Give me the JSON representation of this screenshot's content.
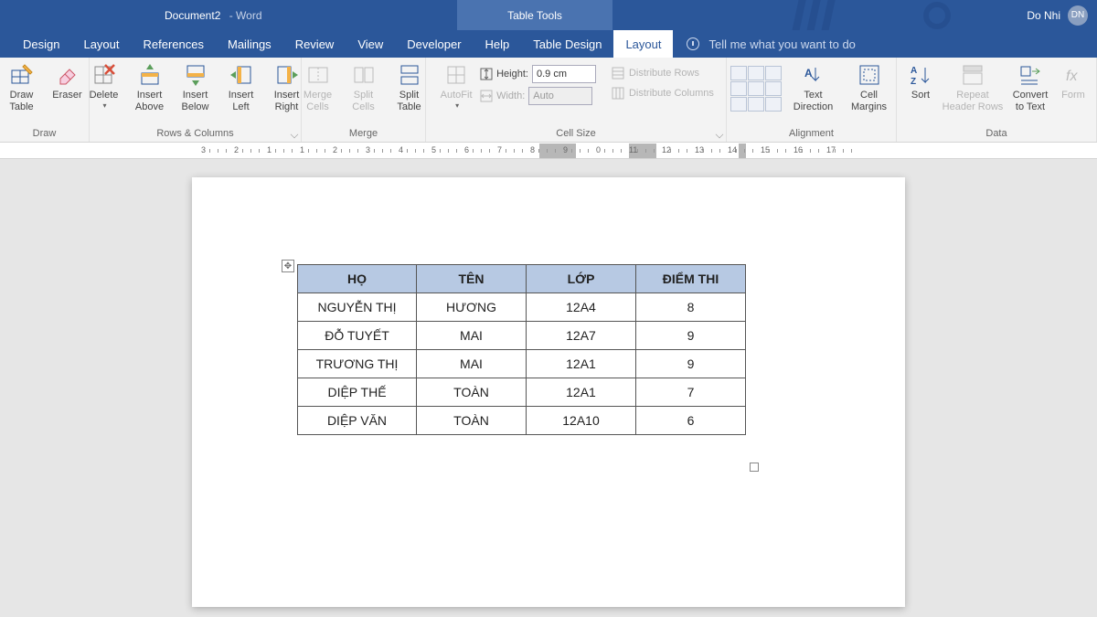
{
  "title": {
    "doc": "Document2",
    "sep": " - ",
    "app": "Word",
    "context": "Table Tools"
  },
  "user": {
    "name": "Do Nhi",
    "initials": "DN"
  },
  "tabs": {
    "list": [
      "Design",
      "Layout",
      "References",
      "Mailings",
      "Review",
      "View",
      "Developer",
      "Help",
      "Table Design",
      "Layout"
    ],
    "active_index": 9,
    "tell_me": "Tell me what you want to do"
  },
  "ribbon": {
    "groups": {
      "draw": {
        "label": "Draw",
        "draw_table": "Draw\nTable",
        "eraser": "Eraser"
      },
      "rowscols": {
        "label": "Rows & Columns",
        "delete": "Delete",
        "ins_above": "Insert\nAbove",
        "ins_below": "Insert\nBelow",
        "ins_left": "Insert\nLeft",
        "ins_right": "Insert\nRight"
      },
      "merge": {
        "label": "Merge",
        "merge_cells": "Merge\nCells",
        "split_cells": "Split\nCells",
        "split_table": "Split\nTable"
      },
      "cellsize": {
        "label": "Cell Size",
        "autofit": "AutoFit",
        "height_lbl": "Height:",
        "height_val": "0.9 cm",
        "width_lbl": "Width:",
        "width_val": "Auto",
        "dist_rows": "Distribute Rows",
        "dist_cols": "Distribute Columns"
      },
      "align": {
        "label": "Alignment",
        "text_dir": "Text\nDirection",
        "cell_marg": "Cell\nMargins"
      },
      "data": {
        "label": "Data",
        "sort": "Sort",
        "repeat": "Repeat\nHeader Rows",
        "convert": "Convert\nto Text",
        "formula": "Form"
      }
    }
  },
  "ruler": {
    "marks": [
      "3",
      "2",
      "1",
      "1",
      "2",
      "3",
      "4",
      "5",
      "6",
      "7",
      "8",
      "9",
      "0",
      "11",
      "12",
      "13",
      "14",
      "15",
      "16",
      "17"
    ]
  },
  "table": {
    "headers": [
      "HỌ",
      "TÊN",
      "LỚP",
      "ĐIỂM THI"
    ],
    "rows": [
      [
        "NGUYỄN THỊ",
        "HƯƠNG",
        "12A4",
        "8"
      ],
      [
        "ĐỖ TUYẾT",
        "MAI",
        "12A7",
        "9"
      ],
      [
        "TRƯƠNG THỊ",
        "MAI",
        "12A1",
        "9"
      ],
      [
        "DIỆP THẾ",
        "TOÀN",
        "12A1",
        "7"
      ],
      [
        "DIỆP VĂN",
        "TOÀN",
        "12A10",
        "6"
      ]
    ]
  }
}
